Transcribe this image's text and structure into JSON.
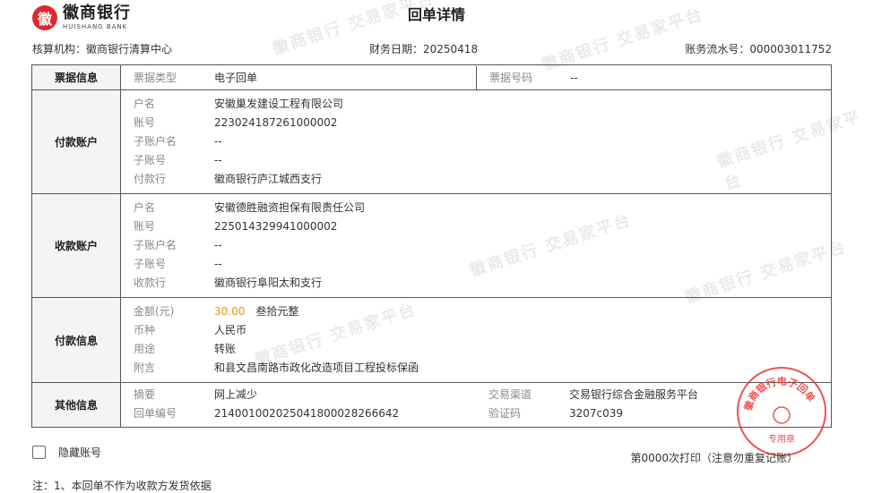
{
  "logo": {
    "name_cn": "徽商银行",
    "name_en": "HUISHANG BANK"
  },
  "title": "回单详情",
  "meta": {
    "org": "核算机构：徽商银行清算中心",
    "date": "财务日期：20250418",
    "serial": "账务流水号：000003011752"
  },
  "sections": {
    "bill": {
      "title": "票据信息",
      "type_label": "票据类型",
      "type_value": "电子回单",
      "no_label": "票据号码",
      "no_value": "--"
    },
    "payer": {
      "title": "付款账户",
      "rows": [
        {
          "label": "户名",
          "value": "安徽巢发建设工程有限公司"
        },
        {
          "label": "账号",
          "value": "223024187261000002"
        },
        {
          "label": "子账户名",
          "value": "--"
        },
        {
          "label": "子账号",
          "value": "--"
        },
        {
          "label": "付款行",
          "value": "徽商银行庐江城西支行"
        }
      ]
    },
    "payee": {
      "title": "收款账户",
      "rows": [
        {
          "label": "户名",
          "value": "安徽德胜融资担保有限责任公司"
        },
        {
          "label": "账号",
          "value": "225014329941000002"
        },
        {
          "label": "子账户名",
          "value": "--"
        },
        {
          "label": "子账号",
          "value": "--"
        },
        {
          "label": "收款行",
          "value": "徽商银行阜阳太和支行"
        }
      ]
    },
    "payment": {
      "title": "付款信息",
      "amount_label": "金额(元)",
      "amount": "30.00",
      "amount_words": "叁拾元整",
      "currency_label": "币种",
      "currency": "人民币",
      "purpose_label": "用途",
      "purpose": "转账",
      "memo_label": "附言",
      "memo": "和县文昌南路市政化改造项目工程投标保函"
    },
    "other": {
      "title": "其他信息",
      "summary_label": "摘要",
      "summary": "网上减少",
      "receipt_no_label": "回单编号",
      "receipt_no": "21400100202504180002826664​2",
      "channel_label": "交易渠道",
      "channel": "交易银行综合金融服务平台",
      "code_label": "验证码",
      "code": "3207c039"
    }
  },
  "hide_account_label": "隐藏账号",
  "print_note": "第0000次打印（注意勿重复记账）",
  "footnote": "注：1、本回单不作为收款方发货依据",
  "stamp": {
    "text": "徽商银行电子回单",
    "sub": "专用章"
  },
  "watermark_text": "徽商银行 交易家平台",
  "colors": {
    "amount": "#f0900e",
    "stamp": "#e33333",
    "brand": "#e3262b"
  }
}
